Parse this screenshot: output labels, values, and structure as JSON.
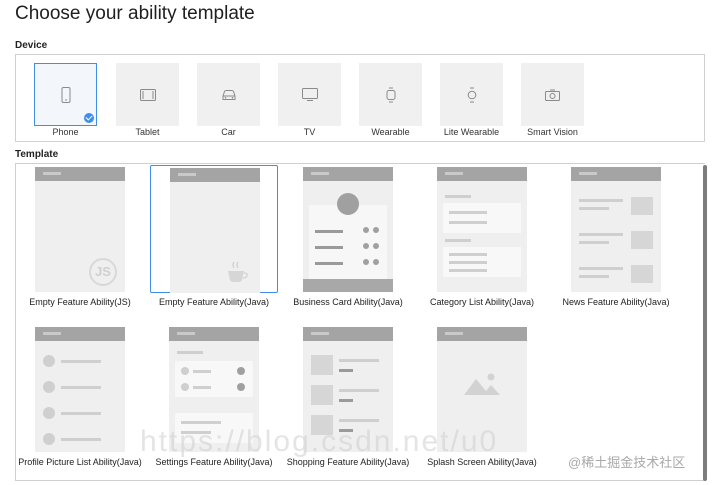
{
  "page": {
    "title": "Choose your ability template"
  },
  "device_section": {
    "label": "Device",
    "items": [
      {
        "label": "Phone",
        "icon": "phone-icon",
        "selected": true
      },
      {
        "label": "Tablet",
        "icon": "tablet-icon",
        "selected": false
      },
      {
        "label": "Car",
        "icon": "car-icon",
        "selected": false
      },
      {
        "label": "TV",
        "icon": "tv-icon",
        "selected": false
      },
      {
        "label": "Wearable",
        "icon": "wearable-icon",
        "selected": false
      },
      {
        "label": "Lite Wearable",
        "icon": "lite-wearable-icon",
        "selected": false
      },
      {
        "label": "Smart Vision",
        "icon": "camera-icon",
        "selected": false
      }
    ]
  },
  "template_section": {
    "label": "Template",
    "items": [
      {
        "label": "Empty Feature Ability(JS)",
        "badge": "JS",
        "selected": false
      },
      {
        "label": "Empty Feature Ability(Java)",
        "badge": "coffee-cup-icon",
        "selected": true
      },
      {
        "label": "Business Card Ability(Java)",
        "selected": false
      },
      {
        "label": "Category List Ability(Java)",
        "selected": false
      },
      {
        "label": "News Feature Ability(Java)",
        "selected": false
      },
      {
        "label": "Profile Picture List Ability(Java)",
        "selected": false
      },
      {
        "label": "Settings Feature Ability(Java)",
        "selected": false
      },
      {
        "label": "Shopping Feature Ability(Java)",
        "selected": false
      },
      {
        "label": "Splash Screen Ability(Java)",
        "selected": false
      }
    ]
  },
  "overlay": {
    "watermark_text": "https://blog.csdn.net/u0",
    "watermark_cn": "@稀土掘金技术社区"
  },
  "colors": {
    "accent": "#3f8ee8",
    "tile": "#f0f0f0",
    "mock_bar": "#a4a4a4"
  }
}
